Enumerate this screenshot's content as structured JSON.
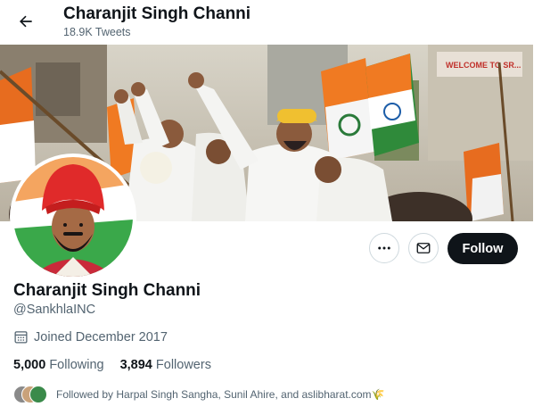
{
  "header": {
    "back_icon": "arrow-left-icon",
    "title": "Charanjit Singh Channi",
    "tweet_count": "18.9K Tweets"
  },
  "banner": {
    "sign_text": "WELCOME TO SR..."
  },
  "actions": {
    "more_icon": "more-horizontal-icon",
    "message_icon": "envelope-icon",
    "follow_label": "Follow"
  },
  "profile": {
    "name": "Charanjit Singh Channi",
    "handle": "@SankhlaINC",
    "joined_icon": "calendar-icon",
    "joined": "Joined December 2017",
    "following_count": "5,000",
    "following_label": "Following",
    "followers_count": "3,894",
    "followers_label": "Followers",
    "followed_by": "Followed by Harpal Singh Sangha, Sunil Ahire, and aslibharat.com🌾"
  },
  "colors": {
    "follow_bg": "#0f1419",
    "secondary_text": "#536471",
    "border": "#cfd9de",
    "turban_saffron": "#f0c030",
    "avatar_turban": "#e02a2a"
  }
}
